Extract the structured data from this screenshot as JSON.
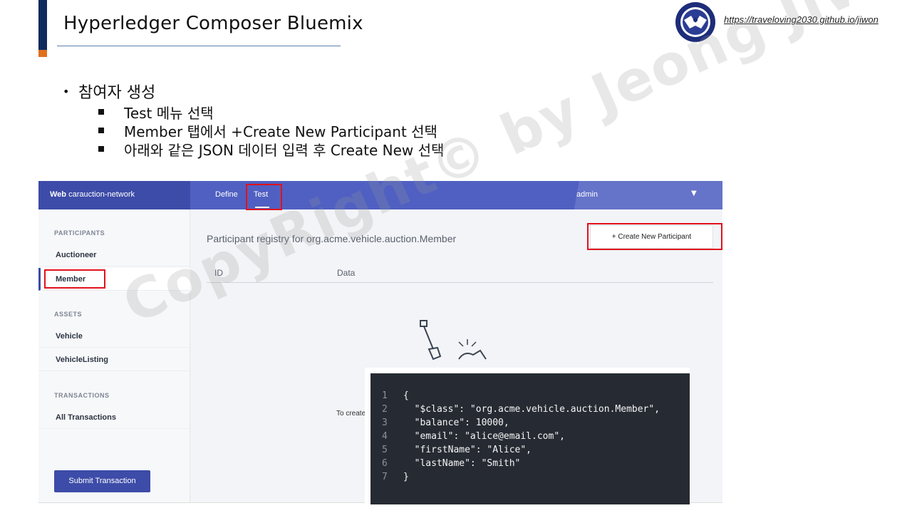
{
  "slide": {
    "title": "Hyperledger Composer Bluemix",
    "url": "https://traveloving2030.github.io/jiwon",
    "bullet_main": "참여자 생성",
    "sub_bullets": [
      "Test 메뉴 선택",
      "Member 탭에서 +Create New Participant 선택",
      "아래와 같은 JSON 데이터 입력 후 Create New 선택"
    ],
    "watermark": "CopyRight© by Jeong JiWon"
  },
  "app": {
    "brand_bold": "Web",
    "brand_name": "carauction-network",
    "tabs": [
      "Define",
      "Test"
    ],
    "user": "admin",
    "sidebar": {
      "participants_header": "PARTICIPANTS",
      "participants": [
        "Auctioneer",
        "Member"
      ],
      "assets_header": "ASSETS",
      "assets": [
        "Vehicle",
        "VehicleListing"
      ],
      "transactions_header": "TRANSACTIONS",
      "transactions": [
        "All Transactions"
      ],
      "submit_label": "Submit Transaction"
    },
    "main": {
      "registry_title": "Participant registry for org.acme.vehicle.auction.Member",
      "create_label": "+ Create New Participant",
      "columns": [
        "ID",
        "Data"
      ],
      "empty_hint": "To create"
    }
  },
  "json_code": {
    "line_numbers": [
      "1",
      "2",
      "3",
      "4",
      "5",
      "6",
      "7"
    ],
    "lines": [
      "{",
      "  \"$class\": \"org.acme.vehicle.auction.Member\",",
      "  \"balance\": 10000,",
      "  \"email\": \"alice@email.com\",",
      "  \"firstName\": \"Alice\",",
      "  \"lastName\": \"Smith\"",
      "}"
    ]
  },
  "colors": {
    "highlight": "#e0121c",
    "topbar": "#5060c2",
    "brand_bg": "#3d4ca8",
    "code_bg": "#262b33"
  }
}
